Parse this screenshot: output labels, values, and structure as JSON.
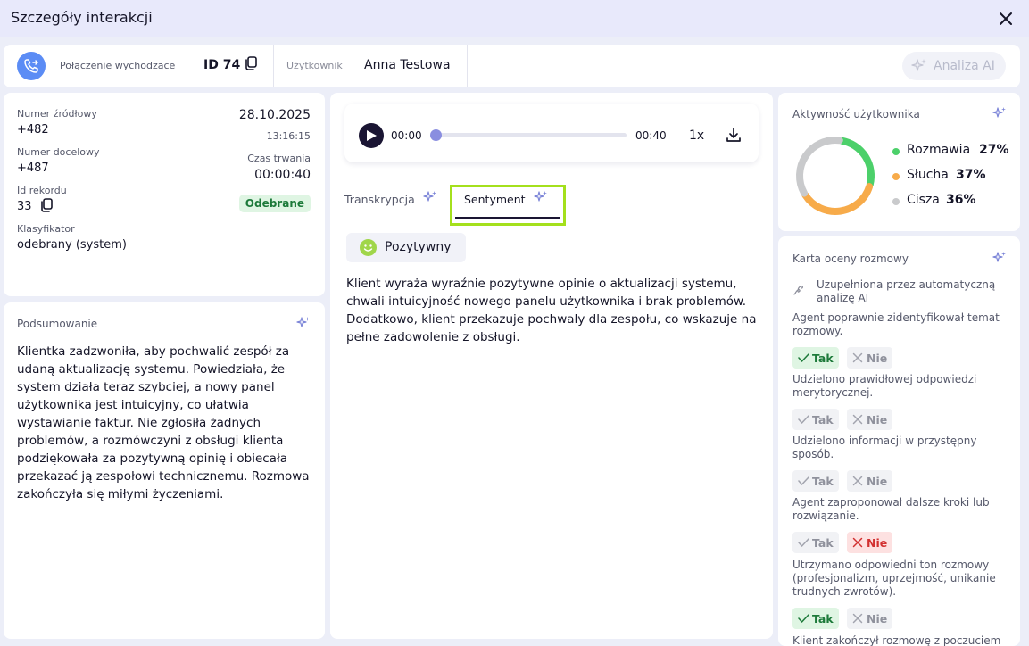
{
  "window": {
    "title": "Szczegóły interakcji"
  },
  "header": {
    "call_type": "Połączenie wychodzące",
    "call_id": "ID 74",
    "user_label": "Użytkownik",
    "user_name": "Anna Testowa",
    "ai_button": "Analiza AI"
  },
  "info": {
    "source_label": "Numer źródłowy",
    "source_value": "+482",
    "dest_label": "Numer docelowy",
    "dest_value": "+487",
    "record_label": "Id rekordu",
    "record_value": "33",
    "classifier_label": "Klasyfikator",
    "classifier_value": "odebrany (system)",
    "date": "28.10.2025",
    "time": "13:16:15",
    "duration_label": "Czas trwania",
    "duration_value": "00:00:40",
    "status": "Odebrane"
  },
  "summary": {
    "title": "Podsumowanie",
    "text": "Klientka zadzwoniła, aby pochwalić zespół za udaną aktualizację systemu. Powiedziała, że system działa teraz szybciej, a nowy panel użytkownika jest intuicyjny, co ułatwia wystawianie faktur. Nie zgłosiła żadnych problemów, a rozmówczyni z obsługi klienta podziękowała za pozytywną opinię i obiecała przekazać ją zespołowi technicznemu. Rozmowa zakończyła się miłymi życzeniami."
  },
  "player": {
    "current": "00:00",
    "total": "00:40",
    "speed": "1x",
    "progress": 0
  },
  "tabs": [
    {
      "label": "Transkrypcja"
    },
    {
      "label": "Sentyment"
    }
  ],
  "sentiment": {
    "label": "Pozytywny",
    "text": "Klient wyraża wyraźnie pozytywne opinie o aktualizacji systemu, chwali intuicyjność nowego panelu użytkownika i brak problemów. Dodatkowo, klient przekazuje pochwały dla zespołu, co wskazuje na pełne zadowolenie z obsługi."
  },
  "activity": {
    "title": "Aktywność użytkownika",
    "items": [
      {
        "name": "Rozmawia",
        "percent": "27%",
        "value": 27,
        "color": "#4cd06a"
      },
      {
        "name": "Słucha",
        "percent": "37%",
        "value": 37,
        "color": "#f7ab4a"
      },
      {
        "name": "Cisza",
        "percent": "36%",
        "value": 36,
        "color": "#c9cacc"
      }
    ]
  },
  "scorecard": {
    "title": "Karta oceny rozmowy",
    "ai_note": "Uzupełniona przez automatyczną analizę AI",
    "yes": "Tak",
    "no": "Nie",
    "questions": [
      {
        "text": "Agent poprawnie zidentyfikował temat rozmowy.",
        "answer": "yes"
      },
      {
        "text": "Udzielono prawidłowej odpowiedzi merytorycznej.",
        "answer": "none"
      },
      {
        "text": "Udzielono informacji w przystępny sposób.",
        "answer": "none"
      },
      {
        "text": "Agent zaproponował dalsze kroki lub rozwiązanie.",
        "answer": "no"
      },
      {
        "text": "Utrzymano odpowiedni ton rozmowy (profesjonalizm, uprzejmość, unikanie trudnych zwrotów).",
        "answer": "yes"
      },
      {
        "text": "Klient zakończył rozmowę z poczuciem",
        "answer": "none"
      }
    ]
  }
}
